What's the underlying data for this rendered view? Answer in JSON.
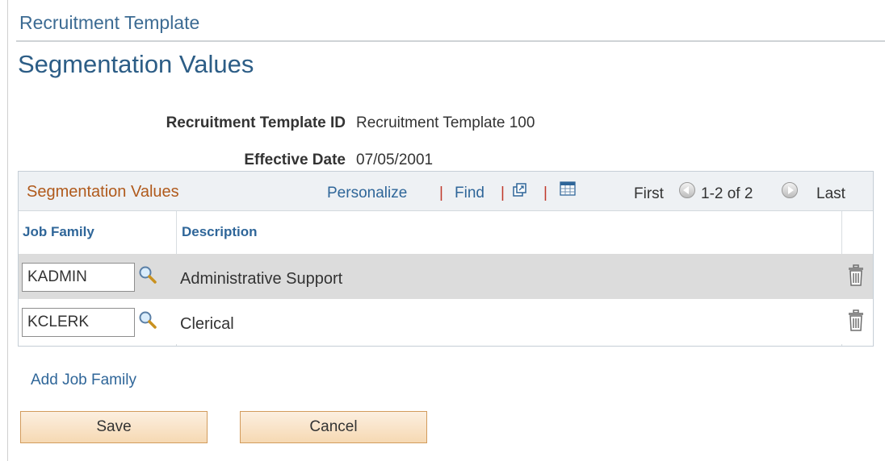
{
  "header": {
    "breadcrumb": "Recruitment Template",
    "title": "Segmentation Values"
  },
  "fields": {
    "template_id": {
      "label": "Recruitment Template ID",
      "value": "Recruitment Template 100"
    },
    "effective_date": {
      "label": "Effective Date",
      "value": "07/05/2001"
    }
  },
  "grid": {
    "title": "Segmentation Values",
    "personalize_label": "Personalize",
    "find_label": "Find",
    "separator": "|",
    "first_label": "First",
    "range_label": "1-2 of 2",
    "last_label": "Last",
    "columns": [
      "Job Family",
      "Description"
    ],
    "rows": [
      {
        "job_family": "KADMIN",
        "description": "Administrative Support"
      },
      {
        "job_family": "KCLERK",
        "description": "Clerical"
      }
    ]
  },
  "actions": {
    "add_label": "Add Job Family",
    "save_label": "Save",
    "cancel_label": "Cancel"
  },
  "colors": {
    "title": "#2c5d86",
    "link": "#2f6699",
    "grid_title": "#b05a1c",
    "row_shade": "#dcdcdc",
    "button_border": "#d29b5c"
  },
  "icons": {
    "lookup": "magnifier-icon",
    "delete": "trash-icon",
    "new_window": "new-window-icon",
    "download": "spreadsheet-icon",
    "prev": "arrow-left-icon",
    "next": "arrow-right-icon"
  }
}
